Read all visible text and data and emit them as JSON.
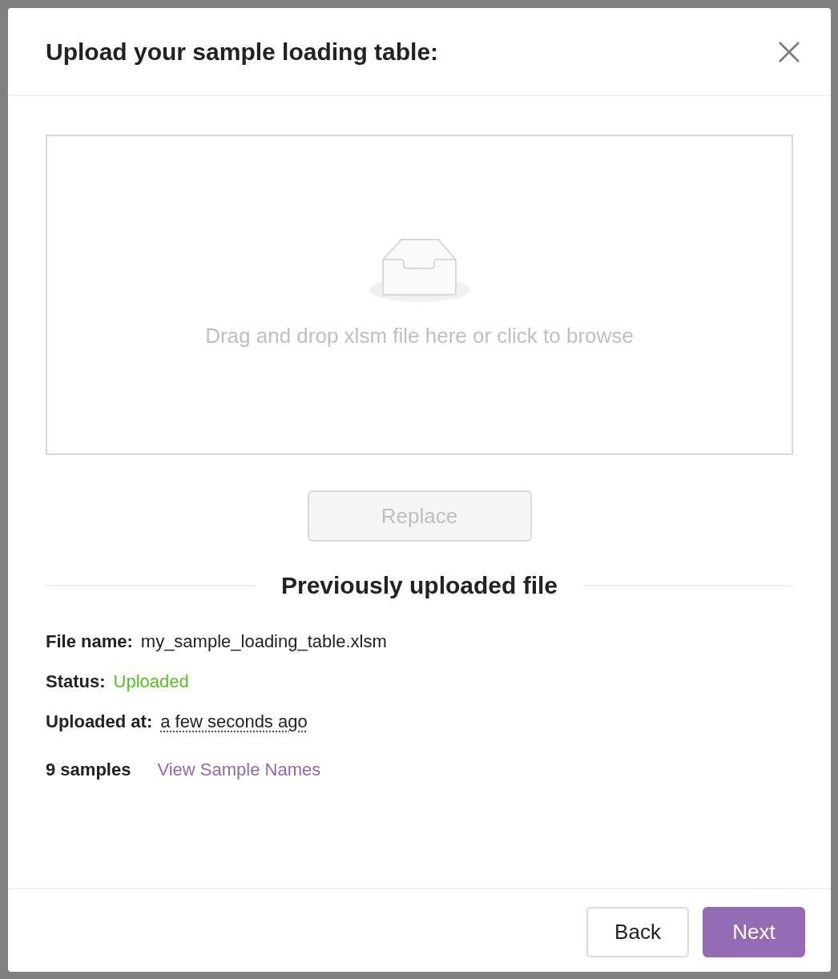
{
  "dialog": {
    "title": "Upload your sample loading table:"
  },
  "dropzone": {
    "text": "Drag and drop xlsm file here or click to browse"
  },
  "replace_button": {
    "label": "Replace",
    "disabled": true
  },
  "section_title": "Previously uploaded file",
  "details": [
    {
      "kind": "text",
      "label": "File name:",
      "value": "my_sample_loading_table.xlsm"
    },
    {
      "kind": "status",
      "label": "Status:",
      "value": "Uploaded"
    },
    {
      "kind": "time",
      "label": "Uploaded at:",
      "value": "a few seconds ago"
    }
  ],
  "samples": {
    "count": "9 samples",
    "link": "View Sample Names"
  },
  "footer_buttons": [
    {
      "kind": "default",
      "label": "Back"
    },
    {
      "kind": "primary",
      "label": "Next"
    }
  ]
}
